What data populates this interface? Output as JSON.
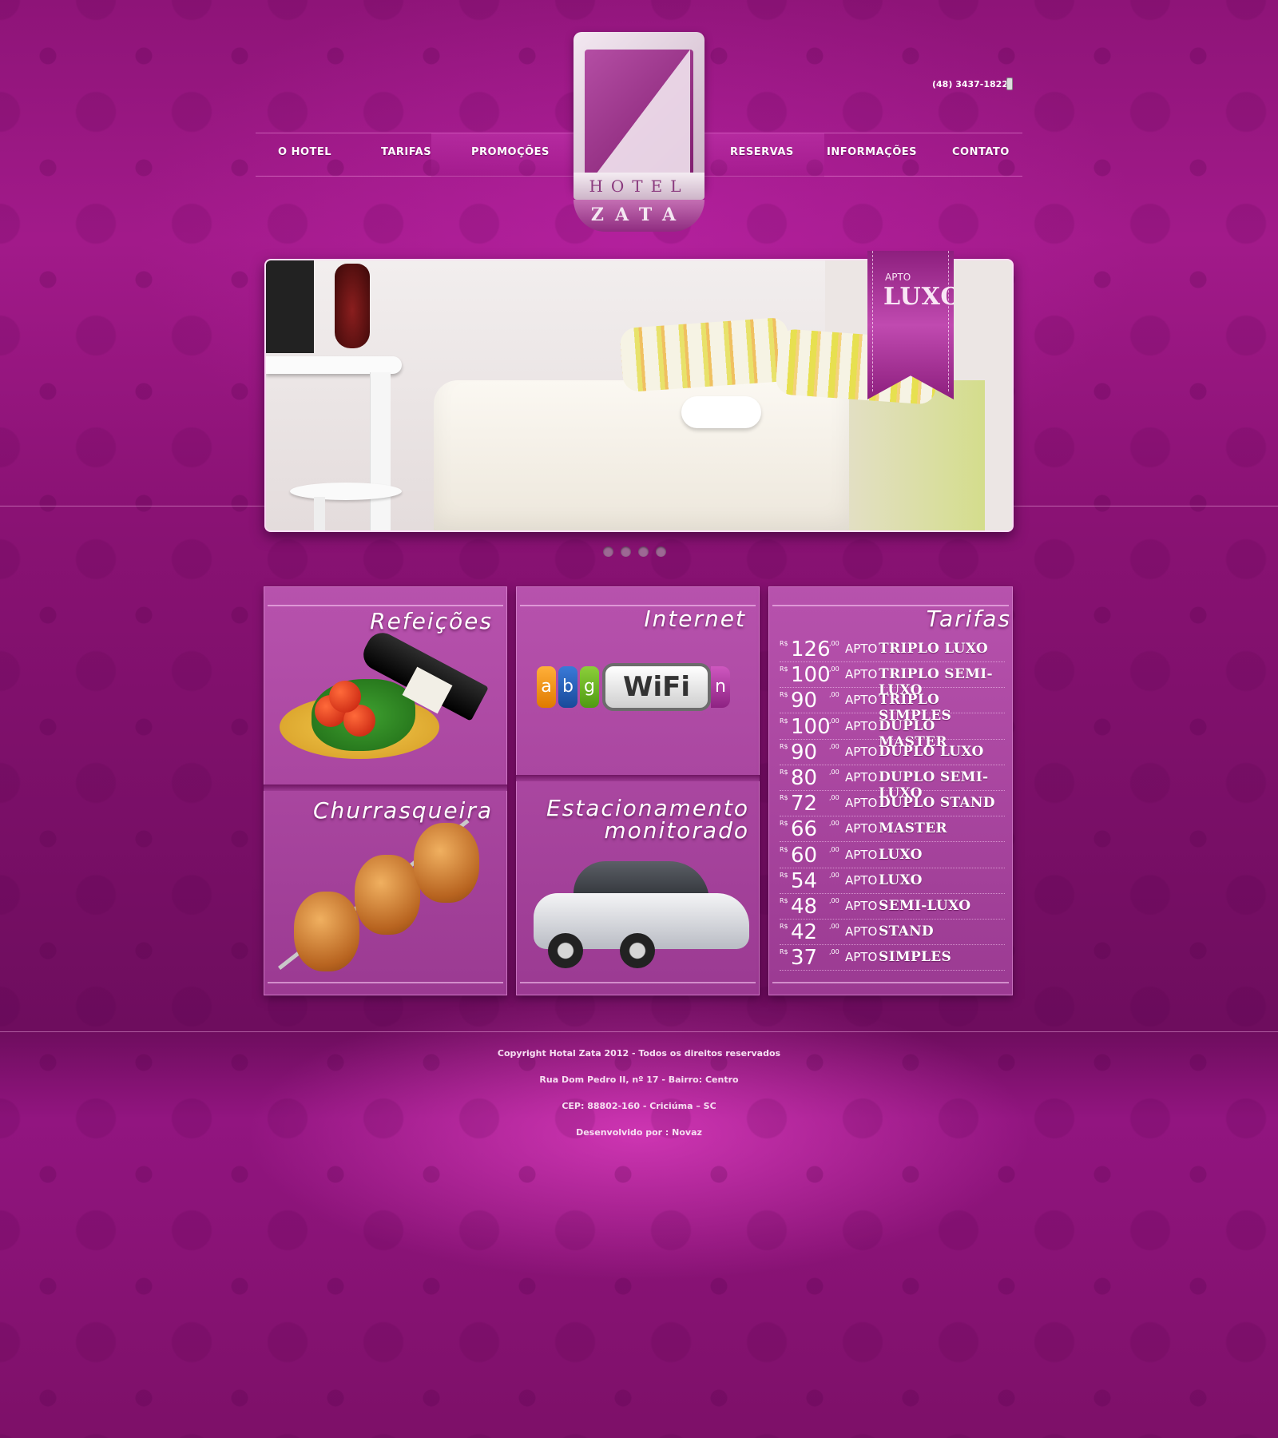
{
  "header": {
    "phone": "(48) 3437-1822",
    "logo": {
      "word1": "HOTEL",
      "word2": "ZATA"
    },
    "nav": [
      {
        "label": "O HOTEL"
      },
      {
        "label": "TARIFAS"
      },
      {
        "label": "PROMOÇÕES"
      },
      {
        "label": "RESERVAS"
      },
      {
        "label": "INFORMAÇÕES"
      },
      {
        "label": "CONTATO"
      }
    ]
  },
  "slider": {
    "ribbon_small": "APTO",
    "ribbon_big": "LUXO",
    "dots": 4
  },
  "cards": {
    "refeicoes": "Refeições",
    "internet": "Internet",
    "wifi_letters": [
      "a",
      "b",
      "g"
    ],
    "wifi_word": "WiFi",
    "wifi_n": "n",
    "churrasqueira": "Churrasqueira",
    "estacionamento_line1": "Estacionamento",
    "estacionamento_line2": "monitorado"
  },
  "tarifas": {
    "title": "Tarifas",
    "currency": "R$",
    "cents": ",00",
    "apto": "APTO",
    "rows": [
      {
        "value": "126",
        "name": "TRIPLO LUXO"
      },
      {
        "value": "100",
        "name": "TRIPLO SEMI-LUXO"
      },
      {
        "value": "90",
        "name": "TRIPLO SIMPLES"
      },
      {
        "value": "100",
        "name": "DUPLO MASTER"
      },
      {
        "value": "90",
        "name": "DUPLO LUXO"
      },
      {
        "value": "80",
        "name": "DUPLO SEMI-LUXO"
      },
      {
        "value": "72",
        "name": "DUPLO STAND"
      },
      {
        "value": "66",
        "name": "MASTER"
      },
      {
        "value": "60",
        "name": "LUXO"
      },
      {
        "value": "54",
        "name": "LUXO"
      },
      {
        "value": "48",
        "name": "SEMI-LUXO"
      },
      {
        "value": "42",
        "name": "STAND"
      },
      {
        "value": "37",
        "name": "SIMPLES"
      }
    ]
  },
  "footer": {
    "copyright": "Copyright Hotal Zata 2012 - Todos os direitos reservados",
    "address": "Rua Dom Pedro II, nº 17 - Bairro: Centro",
    "cep": "CEP: 88802-160 - Criciúma – SC",
    "dev": "Desenvolvido por : Novaz"
  },
  "colors": {
    "background": "#8e1478",
    "panel": "#b752ad",
    "accent": "#f7dff2"
  }
}
